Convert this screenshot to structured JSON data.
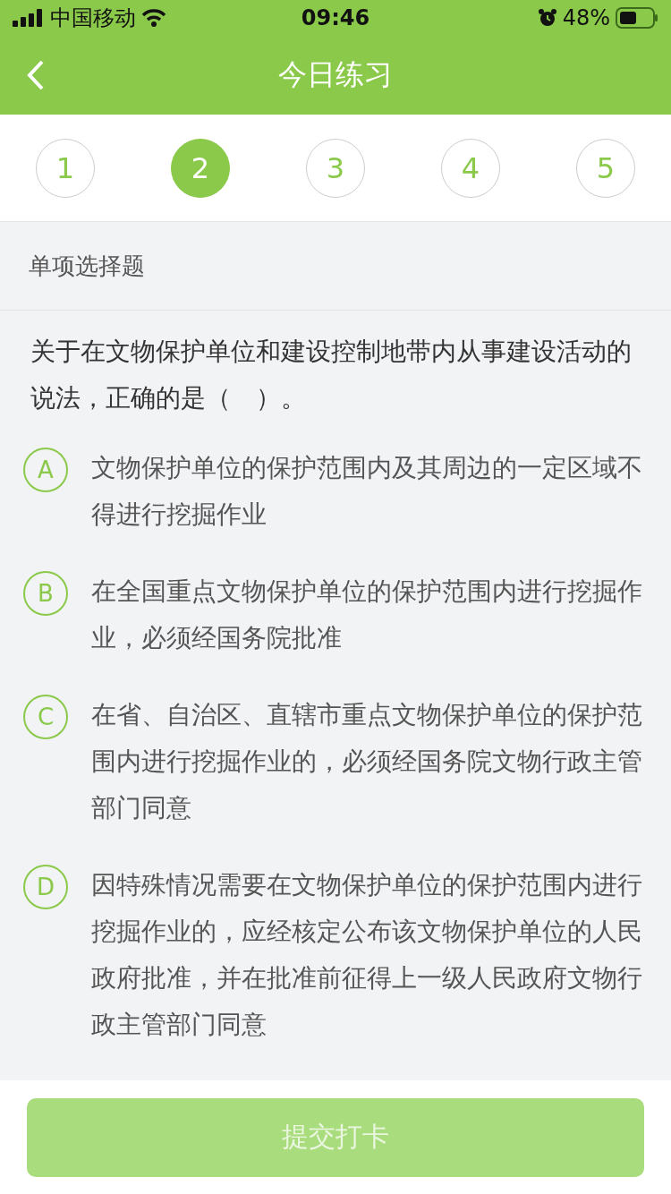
{
  "status_bar": {
    "carrier": "中国移动",
    "time": "09:46",
    "battery": "48%"
  },
  "nav": {
    "title": "今日练习"
  },
  "question_tabs": [
    {
      "label": "1",
      "selected": false
    },
    {
      "label": "2",
      "selected": true
    },
    {
      "label": "3",
      "selected": false
    },
    {
      "label": "4",
      "selected": false
    },
    {
      "label": "5",
      "selected": false
    }
  ],
  "question_type": "单项选择题",
  "question": "关于在文物保护单位和建设控制地带内从事建设活动的说法，正确的是（　）。",
  "options": [
    {
      "letter": "A",
      "text": "文物保护单位的保护范围内及其周边的一定区域不得进行挖掘作业",
      "selected": false
    },
    {
      "letter": "B",
      "text": "在全国重点文物保护单位的保护范围内进行挖掘作业，必须经国务院批准",
      "selected": false
    },
    {
      "letter": "C",
      "text": "在省、自治区、直辖市重点文物保护单位的保护范围内进行挖掘作业的，必须经国务院文物行政主管部门同意",
      "selected": false
    },
    {
      "letter": "D",
      "text": "因特殊情况需要在文物保护单位的保护范围内进行挖掘作业的，应经核定公布该文物保护单位的人民政府批准，并在批准前征得上一级人民政府文物行政主管部门同意",
      "selected": false
    }
  ],
  "submit": {
    "label": "提交打卡",
    "disabled": true
  }
}
